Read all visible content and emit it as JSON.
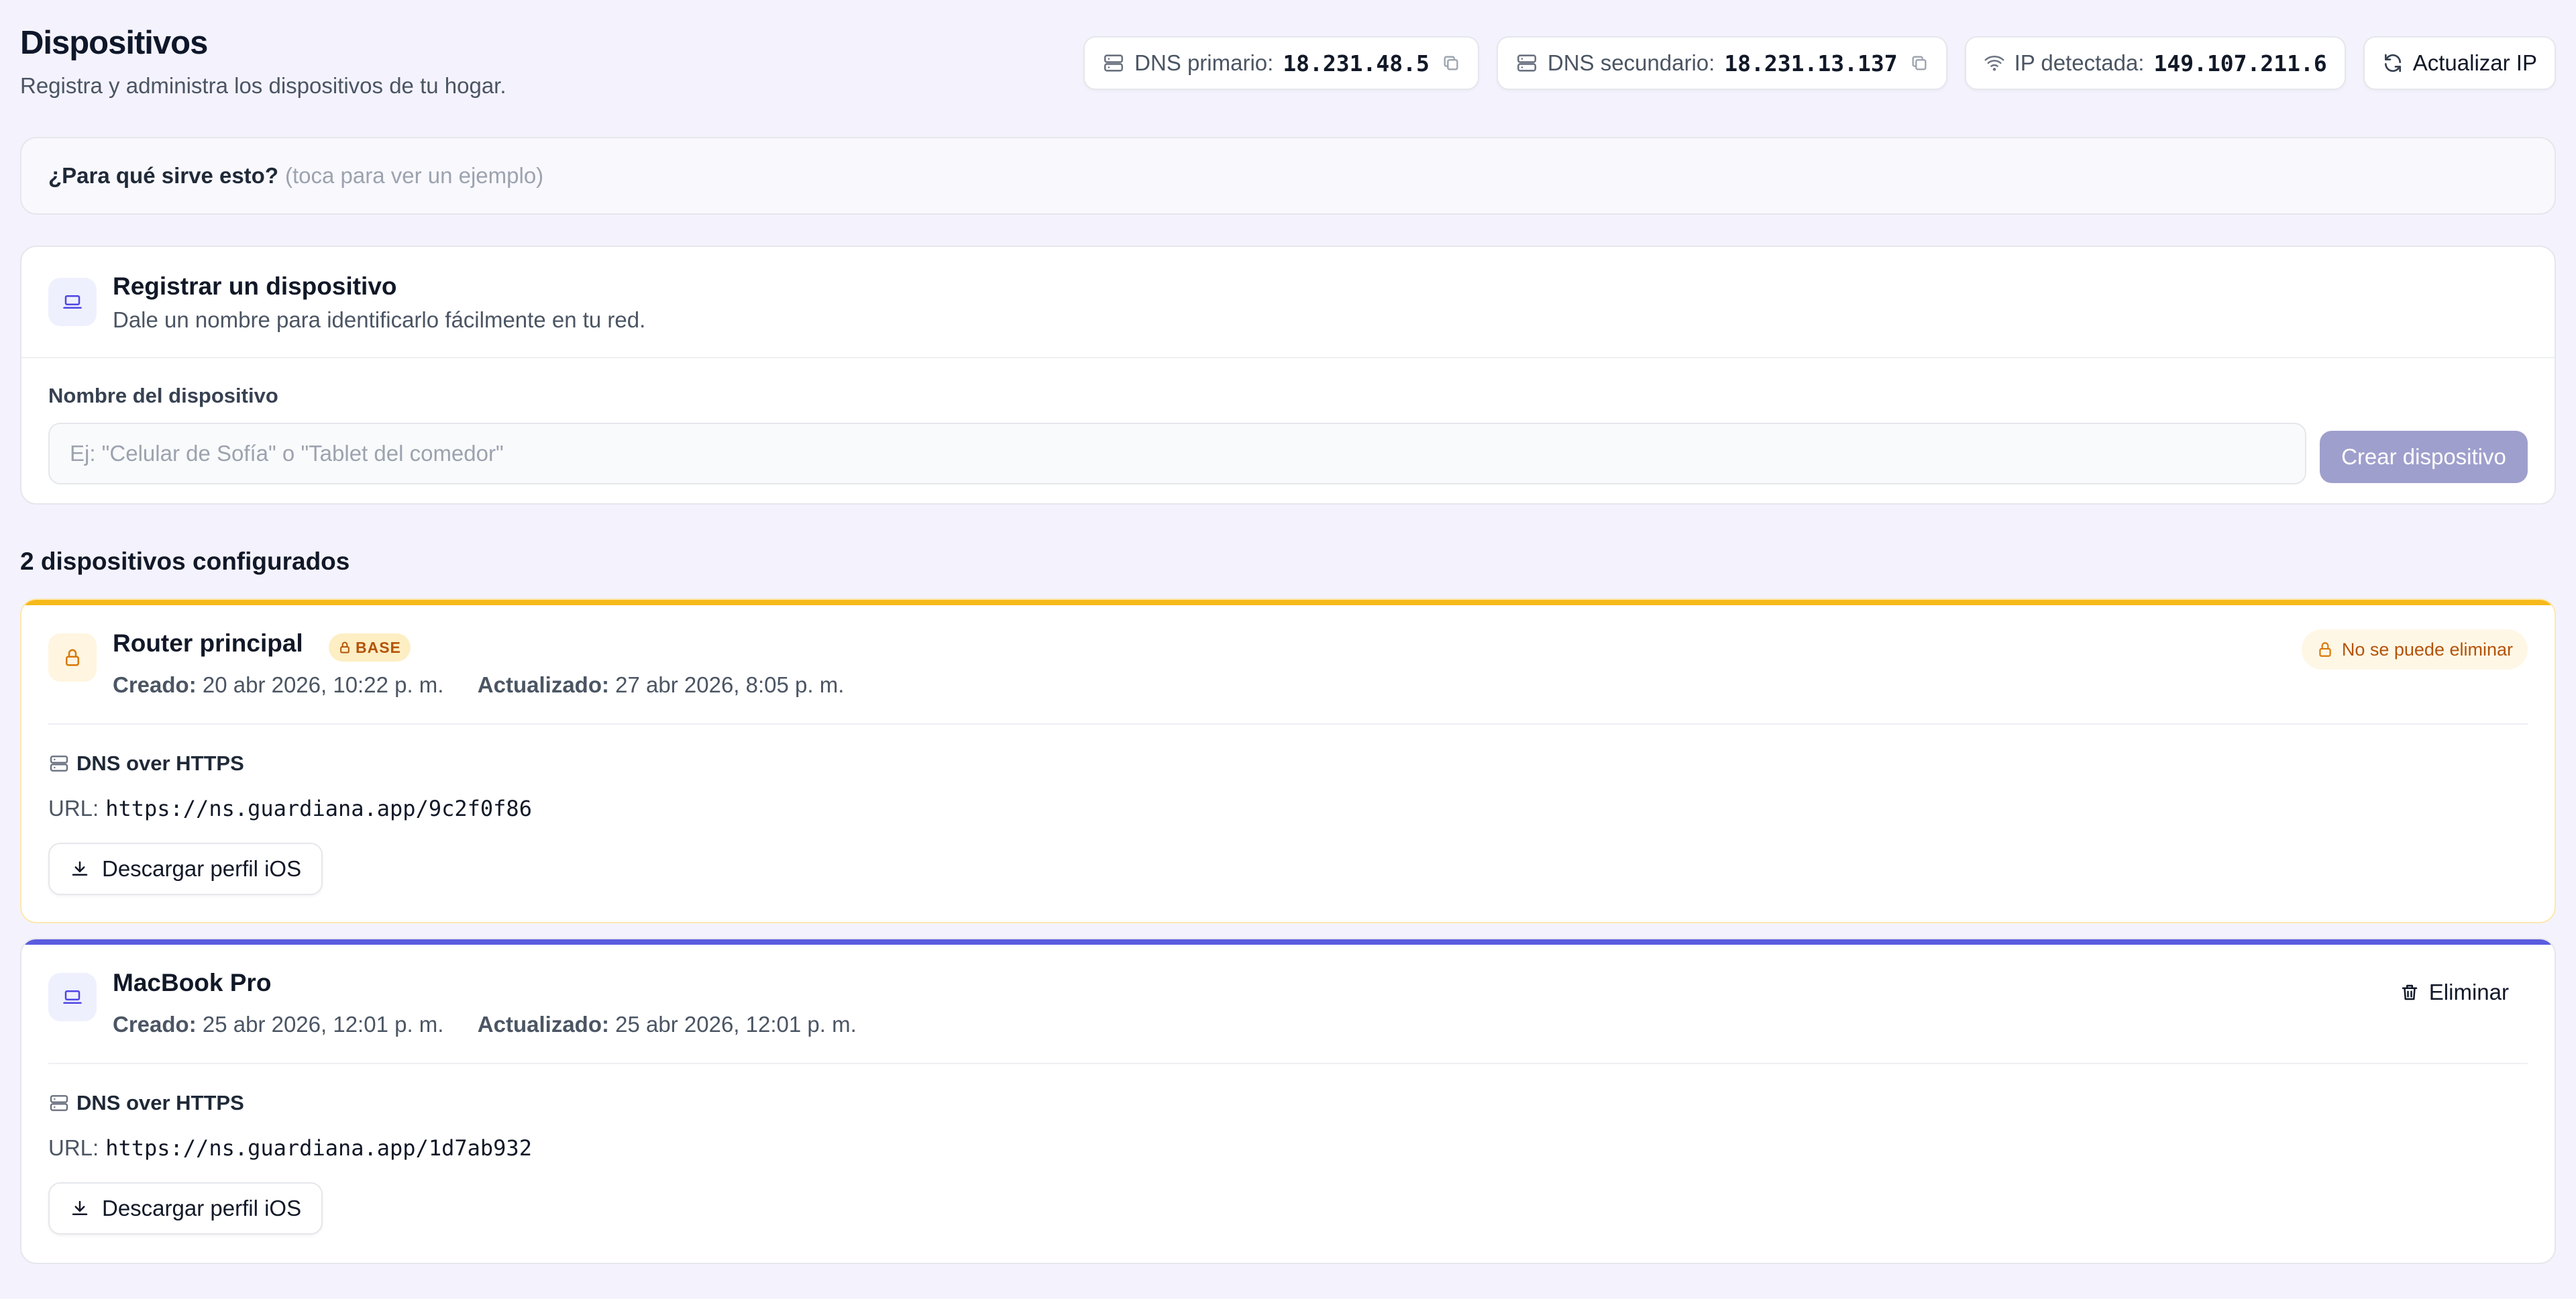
{
  "header": {
    "title": "Dispositivos",
    "subtitle": "Registra y administra los dispositivos de tu hogar.",
    "dns_primary": {
      "label": "DNS primario:",
      "value": "18.231.48.5"
    },
    "dns_secondary": {
      "label": "DNS secundario:",
      "value": "18.231.13.137"
    },
    "ip_detected": {
      "label": "IP detectada:",
      "value": "149.107.211.6"
    },
    "refresh_ip_label": "Actualizar IP"
  },
  "info": {
    "question": "¿Para qué sirve esto?",
    "hint": "(toca para ver un ejemplo)"
  },
  "register": {
    "title": "Registrar un dispositivo",
    "subtitle": "Dale un nombre para identificarlo fácilmente en tu red.",
    "field_label": "Nombre del dispositivo",
    "placeholder": "Ej: \"Celular de Sofía\" o \"Tablet del comedor\"",
    "value": "",
    "create_label": "Crear dispositivo"
  },
  "devices_title": "2 dispositivos configurados",
  "devices": [
    {
      "name": "Router principal",
      "badge": "BASE",
      "created_label": "Creado:",
      "created": "20 abr 2026, 10:22 p. m.",
      "updated_label": "Actualizado:",
      "updated": "27 abr 2026, 8:05 p. m.",
      "protected_label": "No se puede eliminar",
      "doh_label": "DNS over HTTPS",
      "url_label": "URL:",
      "url": "https://ns.guardiana.app/9c2f0f86",
      "download_label": "Descargar perfil iOS",
      "accent_color": "#f6b91a"
    },
    {
      "name": "MacBook Pro",
      "created_label": "Creado:",
      "created": "25 abr 2026, 12:01 p. m.",
      "updated_label": "Actualizado:",
      "updated": "25 abr 2026, 12:01 p. m.",
      "delete_label": "Eliminar",
      "doh_label": "DNS over HTTPS",
      "url_label": "URL:",
      "url": "https://ns.guardiana.app/1d7ab932",
      "download_label": "Descargar perfil iOS",
      "accent_color": "#5b5be0"
    }
  ],
  "colors": {
    "background": "#f4f3fd",
    "primary_accent": "#5b5be0",
    "base_accent": "#f6b91a",
    "disabled_button": "#9f9fcd"
  },
  "icons": [
    "server-icon",
    "copy-icon",
    "wifi-icon",
    "refresh-icon",
    "laptop-icon",
    "lock-icon",
    "download-icon",
    "trash-icon"
  ]
}
